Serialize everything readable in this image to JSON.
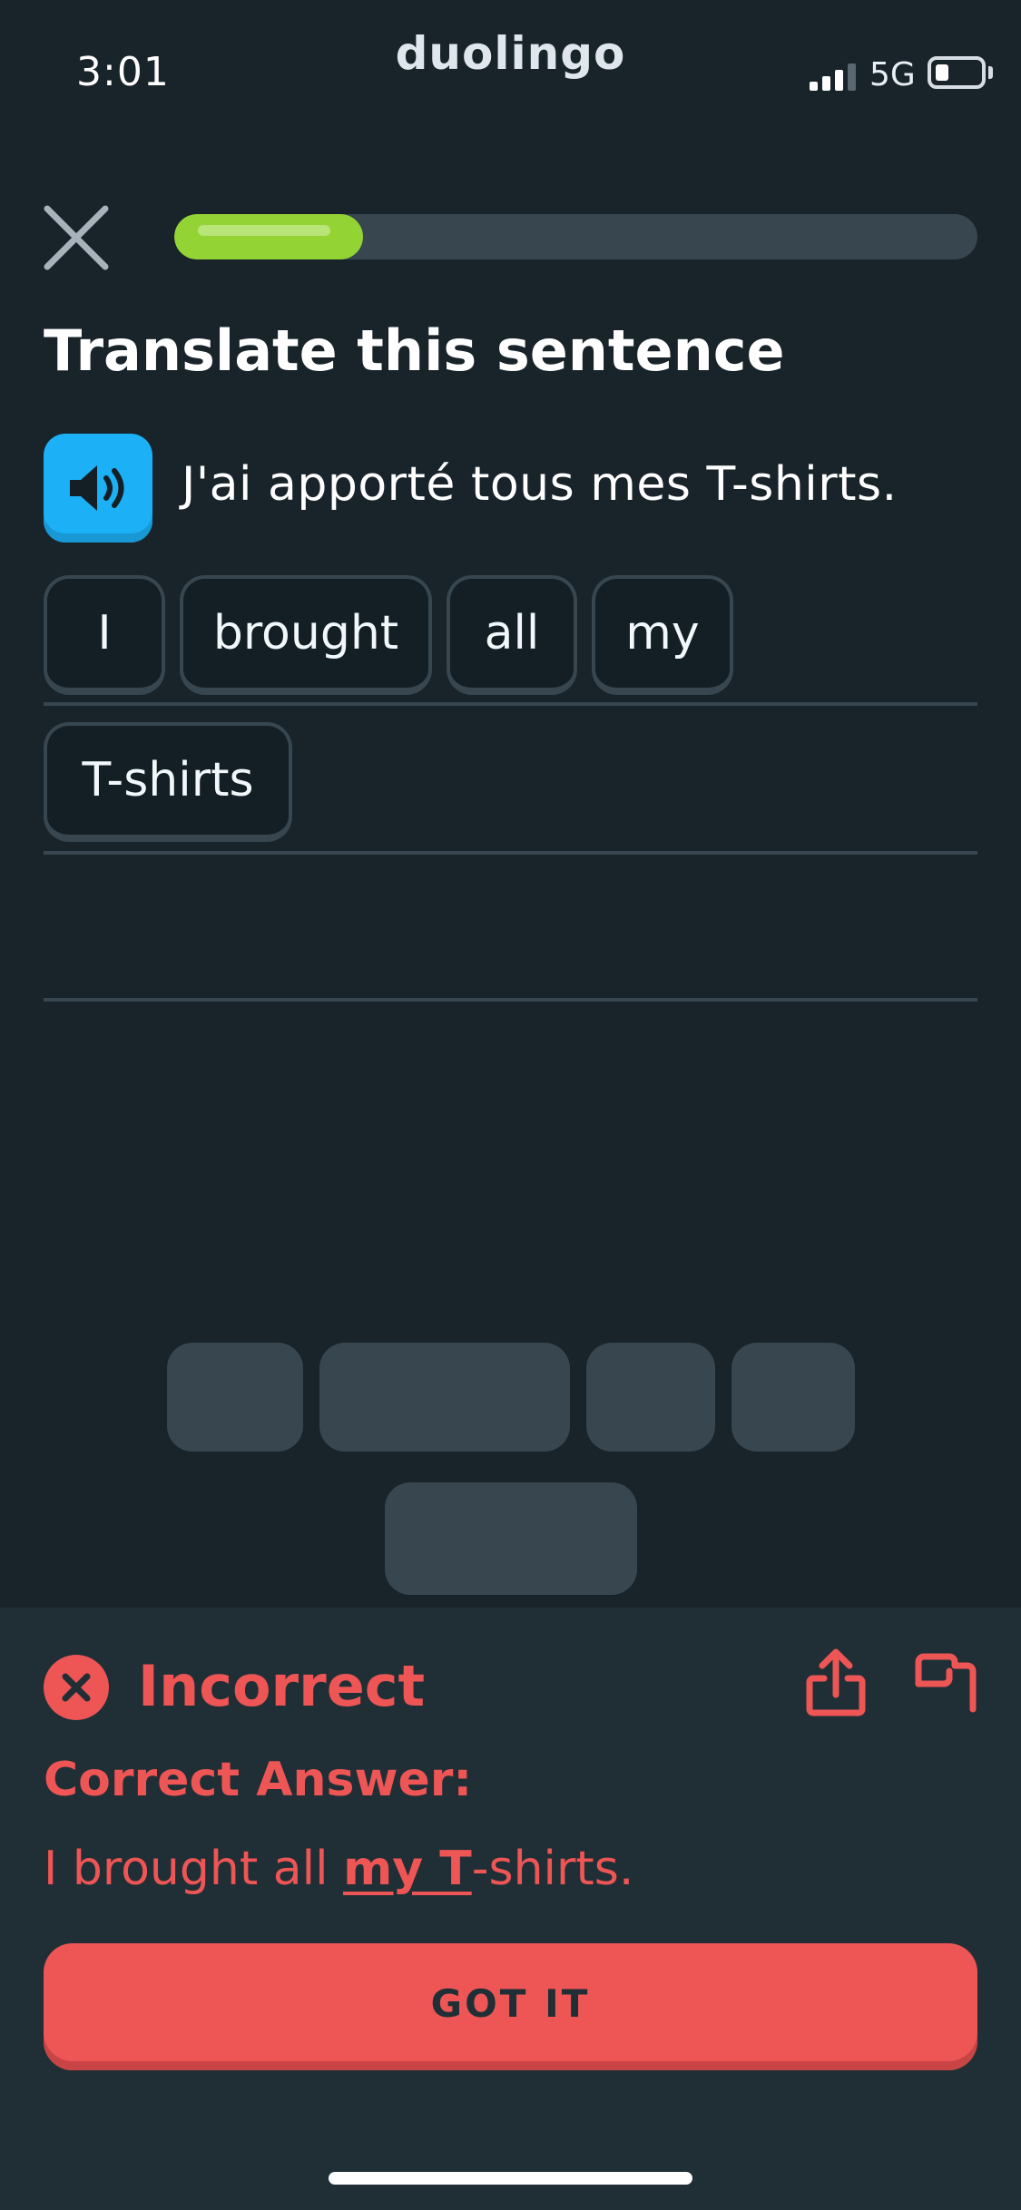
{
  "status_bar": {
    "time": "3:01",
    "app_brand": "duolingo",
    "network": "5G",
    "battery_level": 0.3
  },
  "header": {
    "progress_fraction": 0.235
  },
  "prompt": {
    "title": "Translate this sentence",
    "sentence": "J'ai apporté tous mes T-shirts.",
    "audio_icon": "speaker-icon"
  },
  "answer": {
    "words": [
      "I",
      "brought",
      "all",
      "my",
      "T-shirts"
    ]
  },
  "word_bank": {
    "slots_remaining": 5
  },
  "feedback": {
    "status": "Incorrect",
    "correct_label": "Correct Answer:",
    "answer_parts": {
      "before": "I brought all ",
      "highlight": "my T",
      "after": "-shirts."
    },
    "button_label": "GOT IT",
    "icons": [
      "close-circle-icon",
      "share-icon",
      "flag-icon"
    ]
  },
  "colors": {
    "background": "#18232a",
    "sheet": "#202f36",
    "progress": "#93d333",
    "error": "#ee5555",
    "audio_button": "#1cb0f6",
    "border": "#37464f"
  }
}
